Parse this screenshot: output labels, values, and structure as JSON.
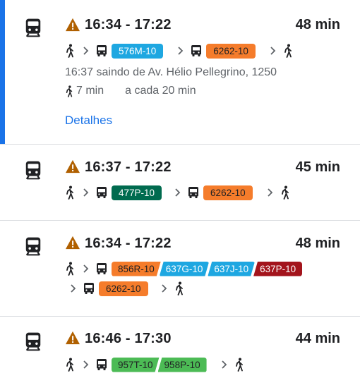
{
  "routes": [
    {
      "times": "16:34 - 17:22",
      "duration": "48 min",
      "lines": [
        {
          "label": "576M-10",
          "color": "#1ea7e1"
        },
        {
          "label": "6262-10",
          "color": "#f57c2b"
        }
      ],
      "departure": "16:37 saindo de Av. Hélio Pellegrino, 1250",
      "walk_time": "7 min",
      "frequency": "a cada 20 min",
      "details_label": "Detalhes"
    },
    {
      "times": "16:37 - 17:22",
      "duration": "45 min",
      "lines": [
        {
          "label": "477P-10",
          "color": "#006b4f"
        },
        {
          "label": "6262-10",
          "color": "#f57c2b"
        }
      ]
    },
    {
      "times": "16:34 - 17:22",
      "duration": "48 min",
      "lines": [
        {
          "label": "856R-10",
          "color": "#f57c2b"
        },
        {
          "label": "637G-10",
          "color": "#1ea7e1"
        },
        {
          "label": "637J-10",
          "color": "#1ea7e1"
        },
        {
          "label": "637P-10",
          "color": "#a3141c"
        },
        {
          "label": "6262-10",
          "color": "#f57c2b"
        }
      ]
    },
    {
      "times": "16:46 - 17:30",
      "duration": "44 min",
      "lines": [
        {
          "label": "957T-10",
          "color": "#4cbb55"
        },
        {
          "label": "958P-10",
          "color": "#4cbb55"
        }
      ]
    }
  ],
  "colors": {
    "accent": "#1a73e8",
    "warning": "#b06000"
  },
  "icons": {
    "mode": "train-icon",
    "warning": "warning-icon",
    "walk": "walk-icon",
    "bus": "bus-icon",
    "chevron": "chevron-right-icon"
  }
}
